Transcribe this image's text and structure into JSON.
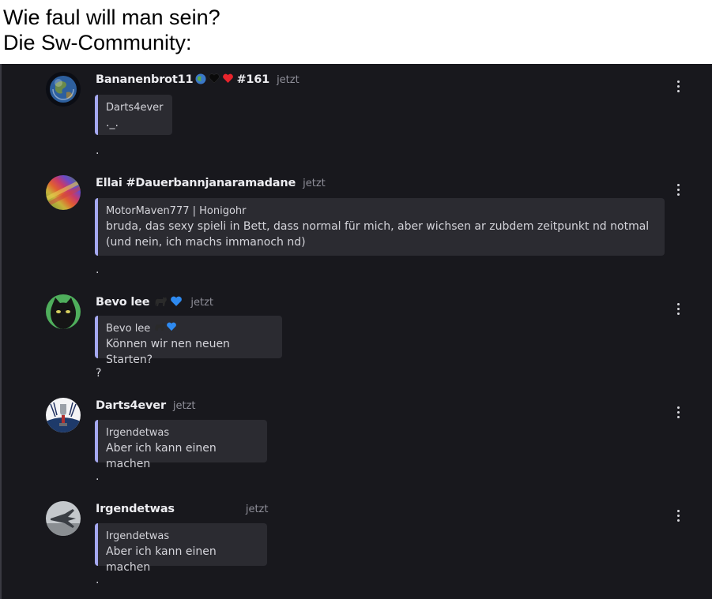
{
  "caption": {
    "line1": "Wie faul will man sein?",
    "line2": "Die Sw-Community:"
  },
  "messages": [
    {
      "author": "Bananenbrot11",
      "author_suffix": "#161",
      "emojis": [
        "globe-icon",
        "black-heart-icon",
        "red-heart-icon"
      ],
      "time": "jetzt",
      "quote_author": "Darts4ever",
      "quote_text": "._.",
      "body": "."
    },
    {
      "author": "Ellai #Dauerbannjanaramadane",
      "time": "jetzt",
      "quote_author": "MotorMaven777 | Honigohr",
      "quote_text": "bruda, das sexy spieli in Bett, dass normal für mich, aber wichsen ar zubdem zeitpunkt nd notmal (und nein, ich machs immanoch nd)",
      "body": "."
    },
    {
      "author": "Bevo lee",
      "emojis": [
        "black-cat-icon",
        "blue-heart-icon"
      ],
      "time": "jetzt",
      "quote_author": "Bevo lee",
      "quote_text": "Können wir nen neuen Starten?",
      "body": "?"
    },
    {
      "author": "Darts4ever",
      "time": "jetzt",
      "quote_author": "Irgendetwas",
      "quote_text": "Aber ich kann einen machen",
      "body": "."
    },
    {
      "author": "Irgendetwas",
      "time": "jetzt",
      "quote_author": "Irgendetwas",
      "quote_text": "Aber ich kann einen machen",
      "body": "."
    }
  ],
  "colors": {
    "background": "#18181d",
    "quote_bg": "#2b2b31",
    "quote_accent": "#a5a8f0"
  }
}
